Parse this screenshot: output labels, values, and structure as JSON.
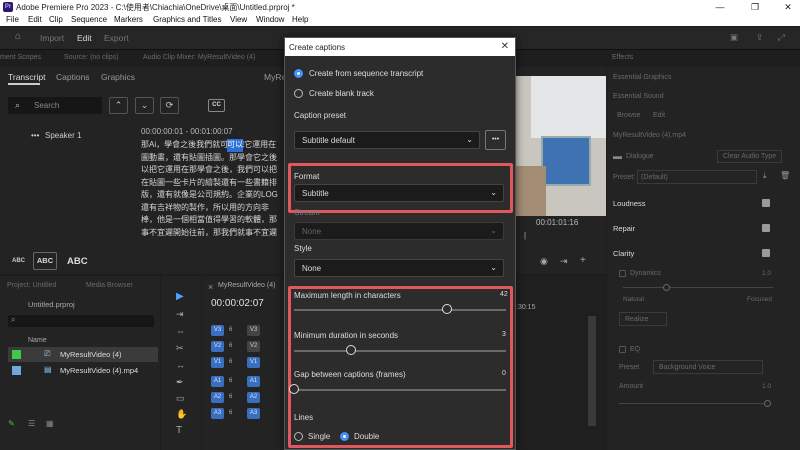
{
  "window": {
    "logo": "Pr",
    "title": "Adobe Premiere Pro 2023 - C:\\使用者\\Chiachia\\OneDrive\\桌面\\Untitled.prproj *",
    "minimize": "—",
    "maximize": "❐",
    "close": "✕"
  },
  "menu": [
    "File",
    "Edit",
    "Clip",
    "Sequence",
    "Markers",
    "Graphics and Titles",
    "View",
    "Window",
    "Help"
  ],
  "topnav": {
    "import": "Import",
    "edit": "Edit",
    "export": "Export"
  },
  "top_panels": {
    "scopes": "ment Scopes",
    "source": "Source: (no clips)",
    "mixer": "Audio Clip Mixer: MyResultVideo (4)",
    "effects": "Effects"
  },
  "transcript": {
    "tabs": [
      "Transcript",
      "Captions",
      "Graphics"
    ],
    "seq_name": "MyRe",
    "search_placeholder": "Search",
    "cc": "CC",
    "speaker": "Speaker 1",
    "timecode": "00:00:00:01 - 00:01:00:07",
    "lines": [
      "那Ai，學會之後我們就可以把它運用在",
      "圖動畫，還有貼圖插圖。那學會它之後",
      "以把它運用在那學會之後，我們可以把",
      "在貼圖一些卡片的繪製還有一些書籍排",
      "版，還有就像是公司規約。企業的LOG",
      "還有吉祥物的製作，所以用的方向非",
      "棒，他是一個相當值得學習的軟體，那",
      "事不宜遲開始往前，那我們就事不宜遲"
    ],
    "highlight": "可以",
    "text_sizes": [
      "ABC",
      "ABC",
      "ABC"
    ]
  },
  "project": {
    "tabs": [
      "Project: Untitled",
      "Media Browser"
    ],
    "file": "Untitled.prproj",
    "col_name": "Name",
    "items": [
      {
        "name": "MyResultVideo (4)",
        "color": "#3ec94a"
      },
      {
        "name": "MyResultVideo (4).mp4",
        "color": "#6fa8dc"
      }
    ]
  },
  "timeline": {
    "tab": "MyResultVideo (4)",
    "timecode": "00:00:02:07",
    "video_tracks": [
      "V3",
      "V2",
      "V1"
    ],
    "audio_tracks": [
      "A1",
      "A2",
      "A3"
    ],
    "ruler": ":30:15"
  },
  "program": {
    "timecode": "00:01:01:16"
  },
  "dialog": {
    "title": "Create captions",
    "options": [
      {
        "label": "Create from sequence transcript",
        "selected": true
      },
      {
        "label": "Create blank track",
        "selected": false
      }
    ],
    "caption_preset_label": "Caption preset",
    "caption_preset_value": "Subtitle default",
    "more": "•••",
    "format_label": "Format",
    "format_value": "Subtitle",
    "stream_label": "Stream",
    "stream_value": "None",
    "style_label": "Style",
    "style_value": "None",
    "max_len_label": "Maximum length in characters",
    "max_len_value": "42",
    "max_len_fraction": 0.72,
    "min_dur_label": "Minimum duration in seconds",
    "min_dur_value": "3",
    "min_dur_fraction": 0.27,
    "gap_label": "Gap between captions (frames)",
    "gap_value": "0",
    "gap_fraction": 0.0,
    "lines_label": "Lines",
    "line_options": [
      {
        "label": "Single",
        "selected": false
      },
      {
        "label": "Double",
        "selected": true
      }
    ]
  },
  "essential_sound": {
    "graphics_tab": "Essential Graphics",
    "title": "Essential Sound",
    "tabs": [
      "Browse",
      "Edit"
    ],
    "clip": "MyResultVideo (4).mp4",
    "dialogue": "Dialogue",
    "clear": "Clear Audio Type",
    "preset_label": "Preset:",
    "preset_value": "(Default)",
    "sections": [
      "Loudness",
      "Repair",
      "Clarity"
    ],
    "dynamics": "Dynamics",
    "dyn_value": "1.0",
    "natural": "Natural",
    "focused": "Focused",
    "realize": "Realize",
    "eq": "EQ",
    "eq_preset_label": "Preset",
    "eq_preset_value": "Background Voice",
    "amount": "Amount",
    "amount_value": "1.0"
  }
}
